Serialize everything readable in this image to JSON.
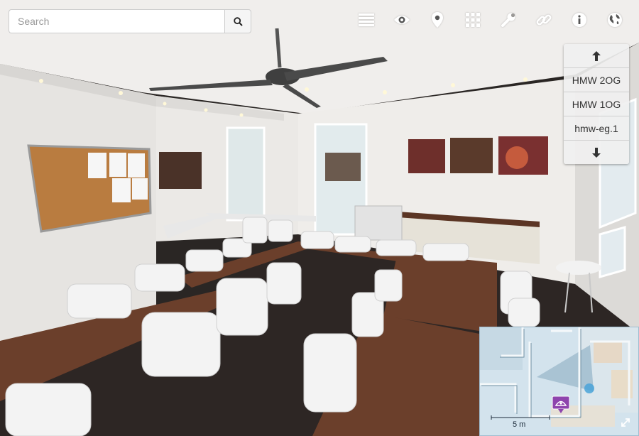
{
  "search": {
    "placeholder": "Search"
  },
  "toolbar": {
    "icons": [
      "list-icon",
      "eye-icon",
      "map-pin-icon",
      "grid-icon",
      "wrench-icon",
      "link-icon",
      "info-icon",
      "globe-icon"
    ]
  },
  "floors": {
    "up_icon": "arrow-up-icon",
    "items": [
      {
        "label": "HMW 2OG"
      },
      {
        "label": "HMW 1OG"
      },
      {
        "label": "hmw-eg.1"
      }
    ],
    "down_icon": "arrow-down-icon"
  },
  "minimap": {
    "scale_label": "5 m"
  },
  "colors": {
    "marker": "#8e44ad",
    "position_dot": "#4aa3d8"
  }
}
